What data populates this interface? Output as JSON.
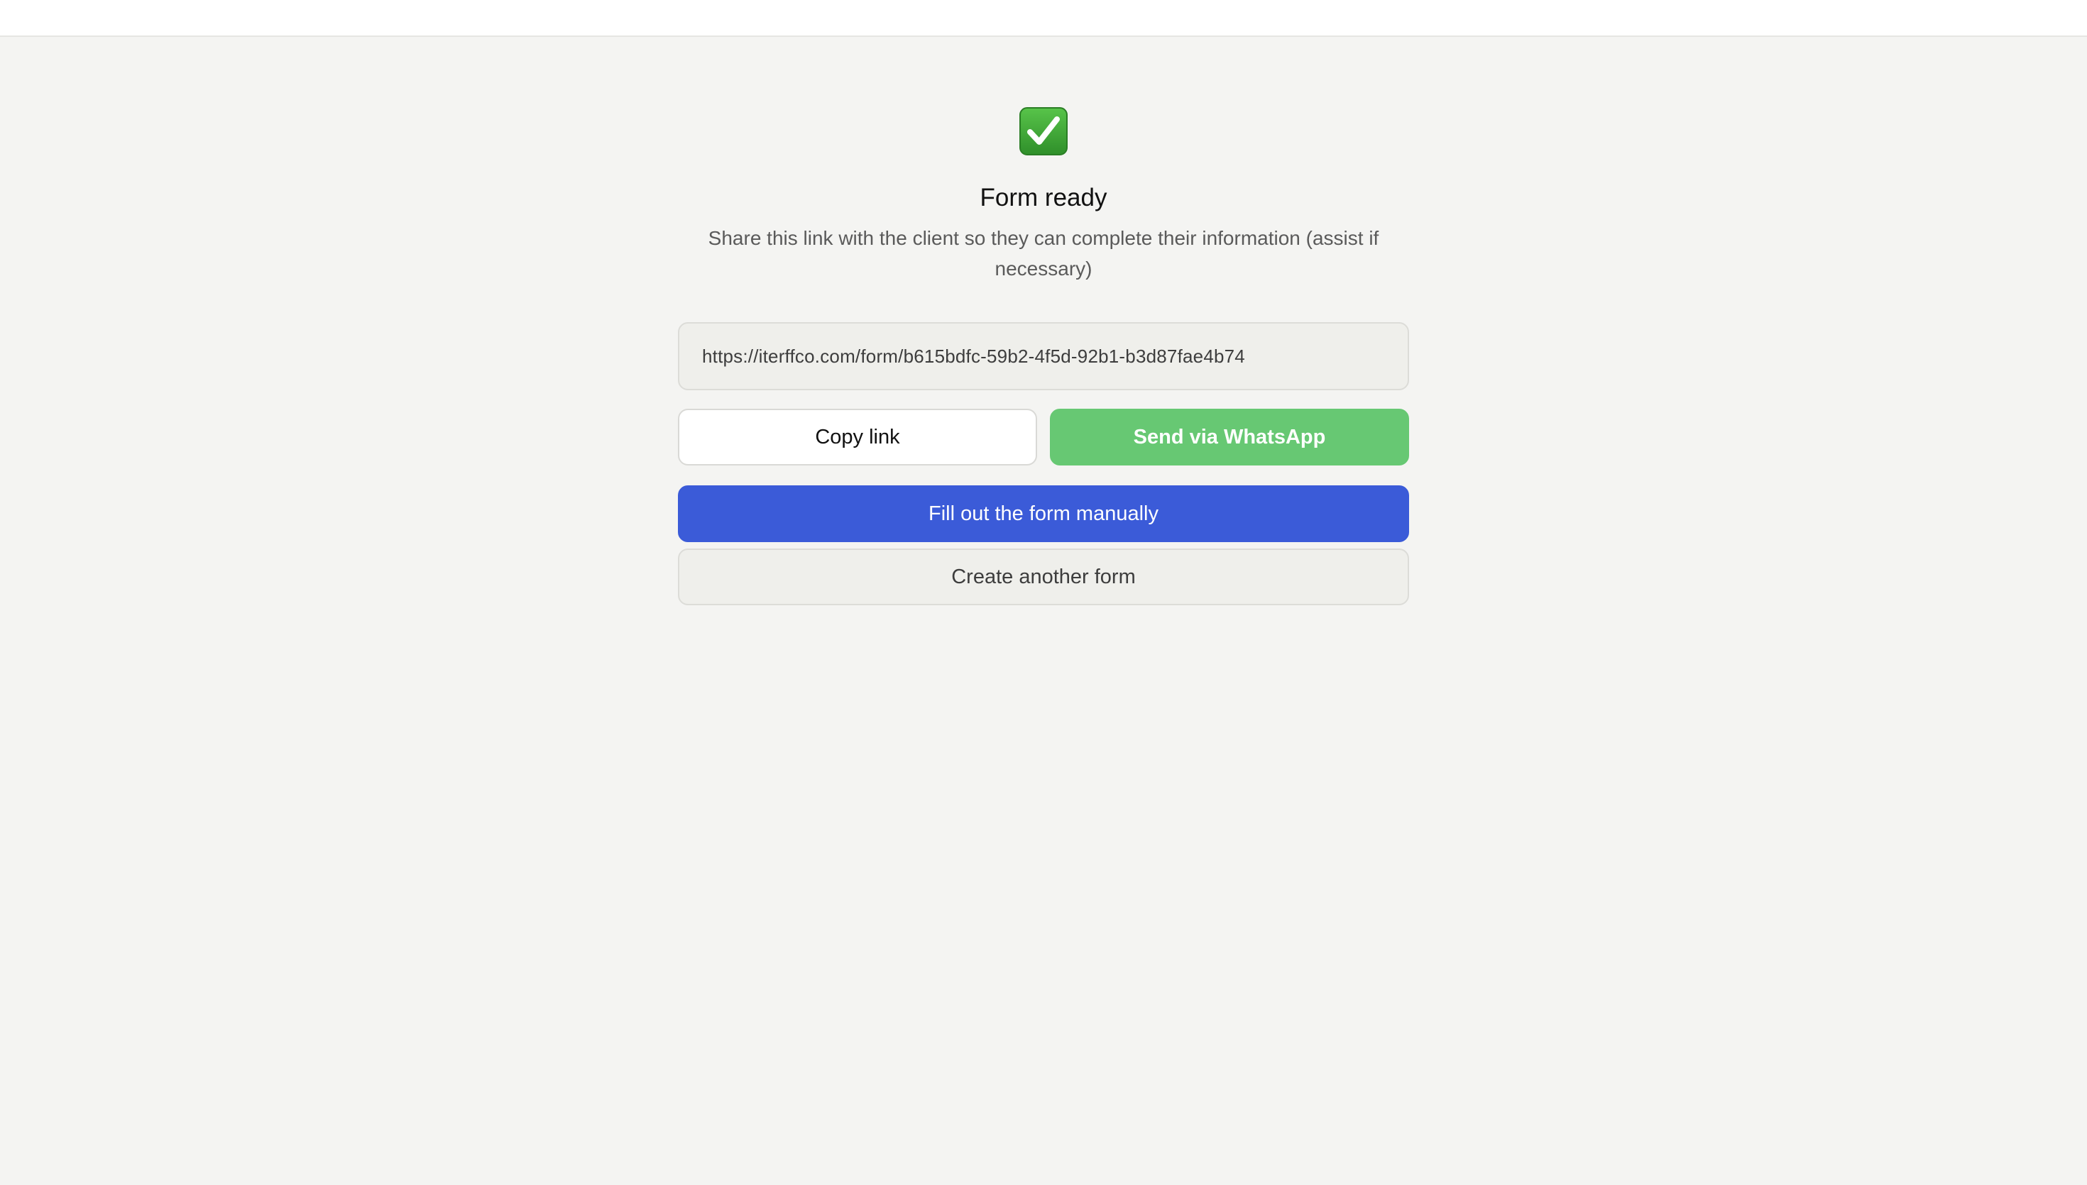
{
  "header": {},
  "success": {
    "icon": "check-mark-button-icon",
    "title": "Form ready",
    "description": "Share this link with the client so they can complete their information (assist if necessary)"
  },
  "link": {
    "url": "https://iterffco.com/form/b615bdfc-59b2-4f5d-92b1-b3d87fae4b74"
  },
  "actions": {
    "copy_label": "Copy link",
    "whatsapp_label": "Send via WhatsApp",
    "manual_label": "Fill out the form manually",
    "another_label": "Create another form"
  },
  "colors": {
    "page_background": "#f4f4f2",
    "whatsapp_green": "#67c873",
    "primary_blue": "#3b5bd8",
    "check_green": "#3fa535"
  }
}
